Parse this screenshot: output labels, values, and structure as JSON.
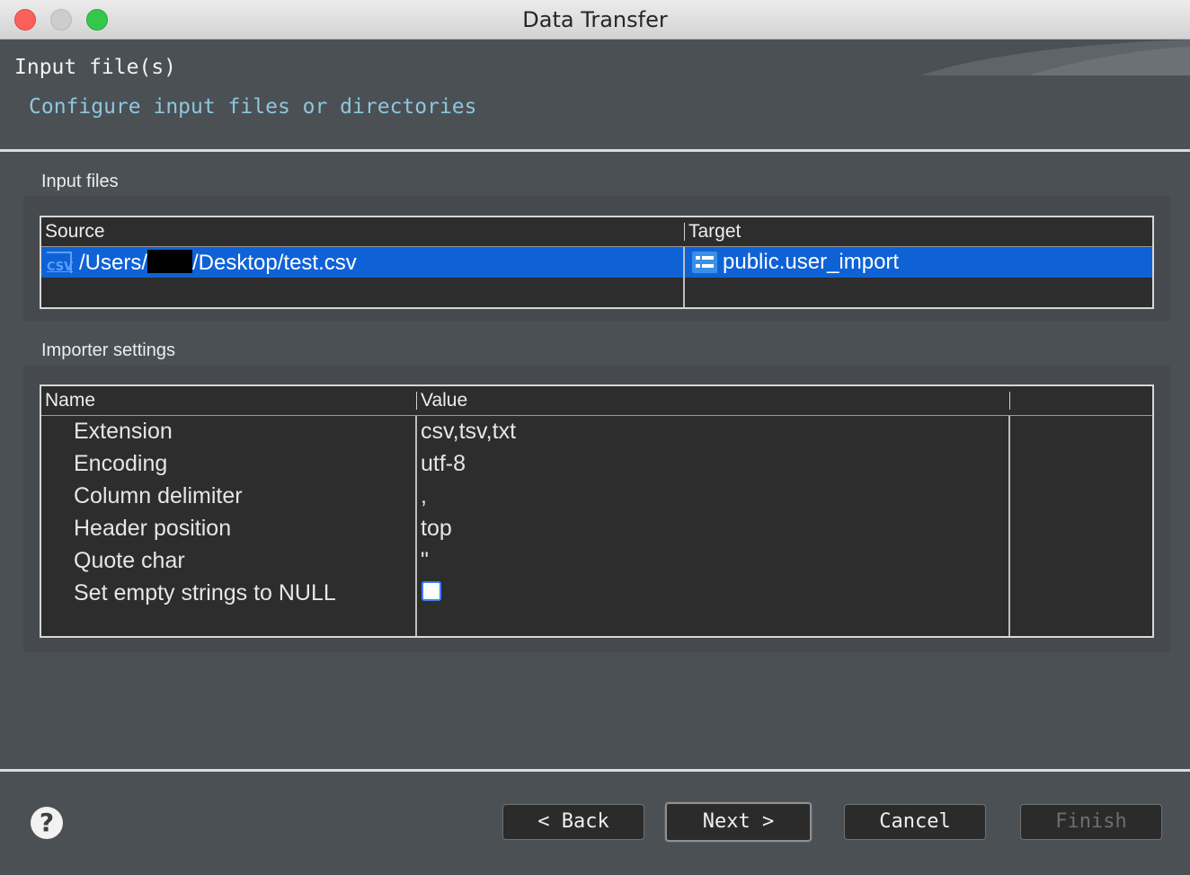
{
  "window": {
    "title": "Data Transfer"
  },
  "header": {
    "title": "Input file(s)",
    "description": "Configure input files or directories"
  },
  "input_files": {
    "group_label": "Input files",
    "columns": [
      "Source",
      "Target"
    ],
    "rows": [
      {
        "source_icon": "csv-file-icon",
        "source_prefix": "/Users/",
        "source_suffix": "/Desktop/test.csv",
        "target_icon": "table-icon",
        "target": "public.user_import",
        "selected": true
      }
    ]
  },
  "importer_settings": {
    "group_label": "Importer settings",
    "columns": [
      "Name",
      "Value",
      ""
    ],
    "rows": [
      {
        "name": "Extension",
        "value": "csv,tsv,txt"
      },
      {
        "name": "Encoding",
        "value": "utf-8"
      },
      {
        "name": "Column delimiter",
        "value": ","
      },
      {
        "name": "Header position",
        "value": "top"
      },
      {
        "name": "Quote char",
        "value": "\""
      },
      {
        "name": "Set empty strings to NULL",
        "value": "",
        "checkbox": true,
        "checked": false
      }
    ]
  },
  "footer": {
    "help_glyph": "?",
    "back_label": "< Back",
    "next_label": "Next >",
    "cancel_label": "Cancel",
    "finish_label": "Finish",
    "finish_enabled": false
  },
  "colors": {
    "selection": "#0f62d6",
    "background": "#4b5054",
    "table_bg": "#2d2d2d",
    "description": "#8ec6de"
  }
}
